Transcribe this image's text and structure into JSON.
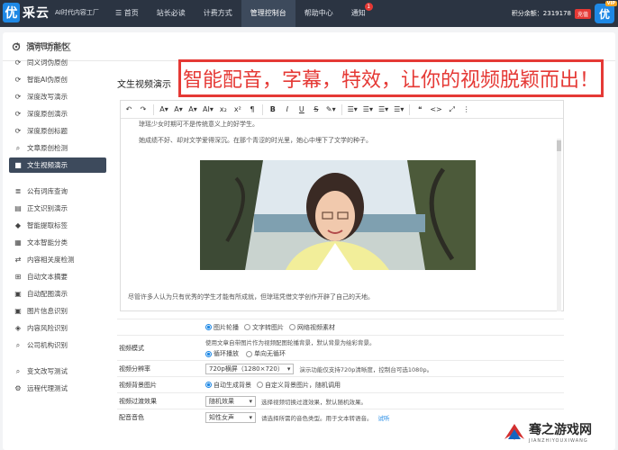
{
  "topbar": {
    "logo_char": "优",
    "logo_name": "采云",
    "logo_sub": "AI时代内容工厂",
    "nav": [
      {
        "label": "☰ 首页"
      },
      {
        "label": "站长必读"
      },
      {
        "label": "计费方式"
      },
      {
        "label": "管理控制台"
      },
      {
        "label": "帮助中心"
      },
      {
        "label": "通知",
        "badge": "1"
      }
    ],
    "credits": "积分余额：2319178",
    "recharge": "充值",
    "avatar_char": "优",
    "vip": "VIP"
  },
  "panel": {
    "title": "演示功能区",
    "title_icon": "settings-icon"
  },
  "sidebar": {
    "items": [
      {
        "label": "回管理控制台",
        "icon": "back-arrow-icon"
      },
      {
        "label": "同义词伪原创",
        "icon": "refresh-icon"
      },
      {
        "label": "智能AI伪原创",
        "icon": "refresh-icon"
      },
      {
        "label": "深度改写演示",
        "icon": "refresh-icon"
      },
      {
        "label": "深度原创演示",
        "icon": "refresh-icon"
      },
      {
        "label": "深度原创标题",
        "icon": "refresh-icon"
      },
      {
        "label": "文章原创检测",
        "icon": "search-icon"
      },
      {
        "label": "文生视频演示",
        "icon": "video-icon"
      },
      {
        "label": "公有词库查询",
        "icon": "list-icon"
      },
      {
        "label": "正文识别演示",
        "icon": "document-icon"
      },
      {
        "label": "智能提取标签",
        "icon": "tag-icon"
      },
      {
        "label": "文本智能分类",
        "icon": "category-icon"
      },
      {
        "label": "内容相关度检测",
        "icon": "compare-icon"
      },
      {
        "label": "自动文本摘要",
        "icon": "summary-icon"
      },
      {
        "label": "自动配图演示",
        "icon": "image-icon"
      },
      {
        "label": "图片信息识别",
        "icon": "image-icon"
      },
      {
        "label": "内容风险识别",
        "icon": "shield-icon"
      },
      {
        "label": "公司机构识别",
        "icon": "search-icon"
      },
      {
        "label": "变文改写测试",
        "icon": "search-icon"
      },
      {
        "label": "远程代理测试",
        "icon": "settings-icon"
      }
    ]
  },
  "main": {
    "headline": "文生视频演示",
    "banner": "智能配音，字幕，特效，让你的视频脱颖而出！"
  },
  "editor": {
    "toolbar": [
      "↶",
      "↷",
      "A▾",
      "A▾",
      "A▾",
      "AI▾",
      "x₂",
      "x²",
      "¶",
      "B",
      "I",
      "U",
      "S",
      "✎▾",
      "☰▾",
      "☰▾",
      "☰▾",
      "☰▾",
      "❝",
      "<>",
      "⤢",
      "⋮"
    ],
    "paragraphs": [
      "琼瑶少女时期可不是传统意义上的好学生。",
      "她成绩不好、却对文学爱得深沉。在那个青涩的时光里，她心中埋下了文学的种子。",
      "尽管许多人认为只有优秀的学生才能有所成就，但琼瑶凭借文学创作开辟了自己的天地。"
    ]
  },
  "settings": {
    "source": {
      "options": [
        "图片轮播",
        "文字转图片",
        "网络视频素材"
      ],
      "selected": 0
    },
    "mode": {
      "label": "视频模式",
      "hint": "使用文章自带图片作为视频配图轮播背景，默认背景为绘彩背景。",
      "options": [
        "循环播放",
        "单向无循环"
      ],
      "selected": 0
    },
    "resolution": {
      "label": "视频分辨率",
      "value": "720p横屏（1280×720）",
      "hint": "演示功能仅支持720p清晰度，控制台可选1080p。"
    },
    "background": {
      "label": "视频背景图片",
      "options": [
        "自动生成背景",
        "自定义背景图片，随机调用"
      ],
      "selected": 0
    },
    "transition": {
      "label": "视频过渡效果",
      "value": "随机效果",
      "hint": "选择视频切换过渡效果，默认随机效果。"
    },
    "voice": {
      "label": "配音音色",
      "value": "知性女声",
      "hint": "请选择所需的音色类型。用于文本转语音。",
      "link": "试听"
    }
  },
  "watermark": {
    "title": "骞之游戏网",
    "sub": "JIANZHIYOUXIWANG"
  }
}
